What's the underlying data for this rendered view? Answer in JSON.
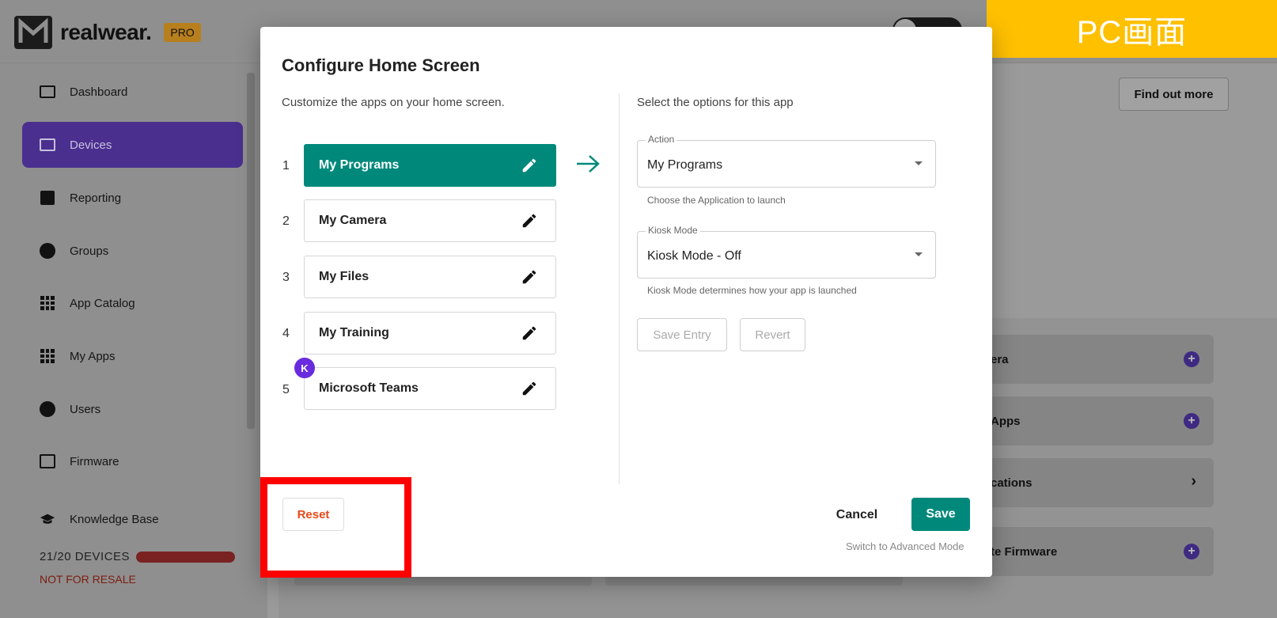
{
  "header": {
    "logo_text": "realwear.",
    "pro_badge": "PRO"
  },
  "overlay_label": "PC画面",
  "sidebar": {
    "items": [
      {
        "label": "Dashboard",
        "icon": "dashboard-icon"
      },
      {
        "label": "Devices",
        "icon": "devices-icon",
        "active": true
      },
      {
        "label": "Reporting",
        "icon": "reporting-icon"
      },
      {
        "label": "Groups",
        "icon": "groups-icon"
      },
      {
        "label": "App Catalog",
        "icon": "app-catalog-icon"
      },
      {
        "label": "My Apps",
        "icon": "my-apps-icon"
      },
      {
        "label": "Users",
        "icon": "users-icon"
      },
      {
        "label": "Firmware",
        "icon": "firmware-icon"
      },
      {
        "label": "Knowledge Base",
        "icon": "knowledge-base-icon"
      }
    ],
    "devices_count": "21/20 DEVICES",
    "resale_notice": "NOT FOR RESALE"
  },
  "background": {
    "find_out_more": "Find out more",
    "cards": [
      {
        "label": "era",
        "action": "plus"
      },
      {
        "label": "Apps",
        "action": "plus"
      },
      {
        "label": "cations",
        "action": "chevron"
      },
      {
        "label": "te Firmware",
        "action": "plus"
      }
    ]
  },
  "dialog": {
    "title": "Configure Home Screen",
    "subtitle": "Customize the apps on your home screen.",
    "apps": [
      {
        "num": "1",
        "name": "My Programs",
        "selected": true
      },
      {
        "num": "2",
        "name": "My Camera"
      },
      {
        "num": "3",
        "name": "My Files"
      },
      {
        "num": "4",
        "name": "My Training"
      },
      {
        "num": "5",
        "name": "Microsoft Teams",
        "badge": "K"
      }
    ],
    "options_title": "Select the options for this app",
    "action": {
      "legend": "Action",
      "value": "My Programs",
      "helper": "Choose the Application to launch"
    },
    "kiosk": {
      "legend": "Kiosk Mode",
      "value": "Kiosk Mode - Off",
      "helper": "Kiosk Mode determines how your app is launched"
    },
    "save_entry": "Save Entry",
    "revert": "Revert",
    "reset": "Reset",
    "cancel": "Cancel",
    "save": "Save",
    "advanced_link": "Switch to Advanced Mode"
  },
  "colors": {
    "accent_teal": "#00897b",
    "sidebar_active": "#4a2f8f",
    "reset_text": "#e64a19",
    "highlight_red": "#ff0000",
    "label_yellow": "#ffc000"
  }
}
